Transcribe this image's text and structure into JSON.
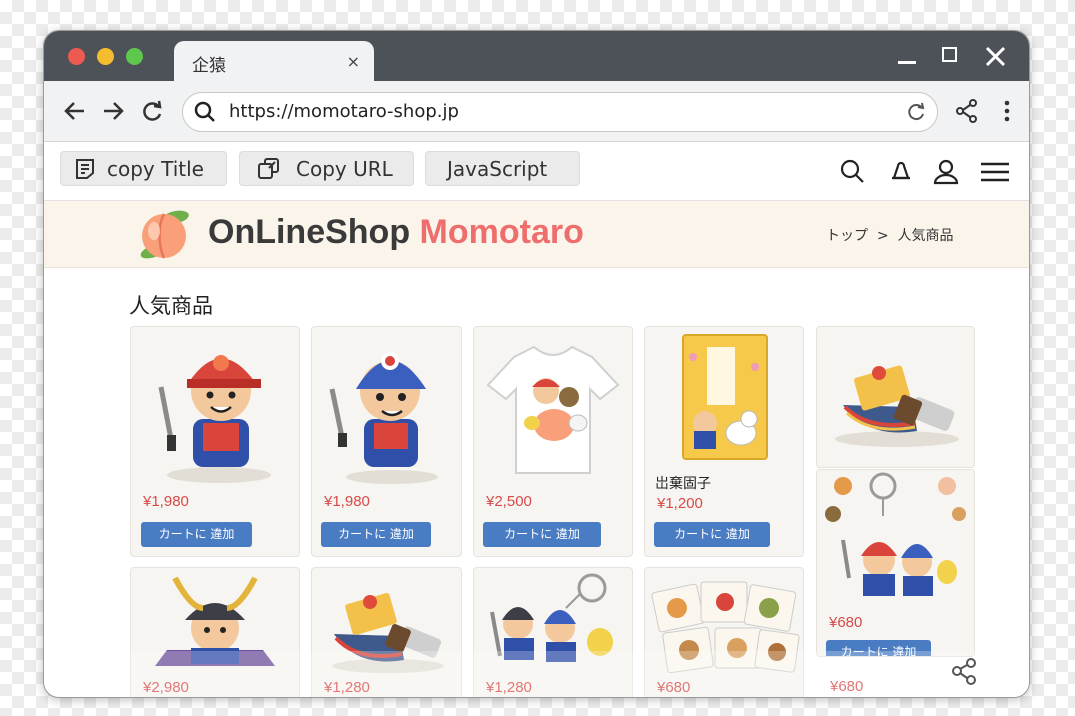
{
  "browser": {
    "tab_title": "企猿",
    "tab_close": "×",
    "url": "https://momotaro-shop.jp"
  },
  "bookmarks": {
    "copy_title": "copy Title",
    "copy_url": "Copy URL",
    "javascript": "JavaScript"
  },
  "shop": {
    "logo_main": "OnLineShop",
    "logo_accent": "Momotaro",
    "breadcrumb": {
      "home": "トップ",
      "separator": ">",
      "current": "人気商品"
    },
    "section_title": "人気商品",
    "cart_label": "カートに 違加"
  },
  "products": [
    {
      "price": "¥1,980"
    },
    {
      "price": "¥1,980"
    },
    {
      "price": "¥2,500"
    },
    {
      "name": "岀棄固子",
      "price": "¥1,200"
    },
    {
      "price": ""
    },
    {
      "price": "¥680"
    },
    {
      "price": "¥2,980"
    },
    {
      "price": "¥1,280"
    },
    {
      "price": "¥1,280"
    },
    {
      "price": "¥680"
    },
    {
      "price": "¥680"
    }
  ],
  "colors": {
    "accent": "#ee6d6d",
    "price": "#d74a4a",
    "button": "#4a7cc4",
    "titlebar": "#4d5259"
  },
  "icons": [
    "back-icon",
    "forward-icon",
    "reload-icon",
    "search-icon",
    "refresh-icon",
    "share-icon",
    "more-icon",
    "notes-icon",
    "copy-link-icon",
    "user-icon",
    "bell-icon",
    "menu-icon",
    "peach-logo-icon"
  ]
}
